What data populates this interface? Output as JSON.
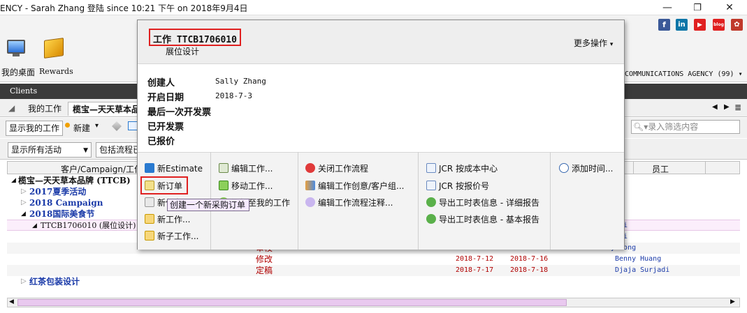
{
  "window": {
    "title": "ENCY  - Sarah Zhang 登陆 since 10:21 下午 on 2018年9月4日",
    "controls": {
      "minimize": "—",
      "maximize": "❐",
      "close": "✕"
    }
  },
  "social": [
    "f",
    "in",
    "▶",
    "blog",
    "✿"
  ],
  "toolbar": {
    "desktop_label": "我的桌面",
    "rewards_label": "Rewards",
    "agency": "COMMUNICATIONS AGENCY (99)",
    "agency_caret": "▾"
  },
  "section_title": "Clients",
  "tabs": {
    "my_jobs": "我的工作",
    "client_tab": "榄宝—天天草本品",
    "nav_prev": "◀",
    "nav_next": "▶",
    "nav_menu": "≣"
  },
  "filters": {
    "show_my_jobs": "显示我的工作",
    "new_btn": "新建",
    "new_caret": "▾",
    "search_placeholder": "录入筛选内容",
    "all_activities": "显示所有活动",
    "include_flow": "包括流程已"
  },
  "grid": {
    "col_client": "客户/Campaign/工作",
    "col_employee": "员工",
    "tree": [
      {
        "indent": 0,
        "arrow": "◢",
        "text": "榄宝—天天草本品牌 (TTCB)",
        "style": "bold-black"
      },
      {
        "indent": 1,
        "arrow": "▷",
        "text": "2017夏季活动",
        "style": "blue"
      },
      {
        "indent": 1,
        "arrow": "▷",
        "text": "2018 Campaign",
        "style": "blue"
      },
      {
        "indent": 1,
        "arrow": "◢",
        "text": "2018国际美食节",
        "style": "blue"
      },
      {
        "indent": 2,
        "arrow": "◢",
        "text": "TTCB1706010 (展位设计)",
        "style": "normal"
      }
    ],
    "employees_partial": [
      "y Qi",
      "y Qi",
      "y Wong"
    ],
    "tasks": [
      {
        "task": "修改",
        "start": "2018-7-12",
        "end": "2018-7-16",
        "employee": "Benny Huang"
      },
      {
        "task": "定稿",
        "start": "2018-7-17",
        "end": "2018-7-18",
        "employee": "Djaja Surjadi"
      }
    ],
    "partial_row": {
      "task": "审校",
      "start": "2018-7-1",
      "end": "2018-7-1"
    },
    "last_row": {
      "arrow": "▷",
      "text": "红茶包装设计"
    }
  },
  "popup": {
    "job_title": "工作 TTCB1706010",
    "job_subtitle": "展位设计",
    "more_ops": "更多操作",
    "more_caret": "▾",
    "info": [
      {
        "label": "创建人",
        "value": "Sally Zhang"
      },
      {
        "label": "开启日期",
        "value": "2018-7-3"
      },
      {
        "label": "最后一次开发票",
        "value": ""
      },
      {
        "label": "已开发票",
        "value": ""
      },
      {
        "label": "已报价",
        "value": ""
      }
    ],
    "col1": [
      "新Estimate",
      "新订单",
      "新任务",
      "新工作...",
      "新子工作..."
    ],
    "col2": [
      "编辑工作...",
      "移动工作...",
      "添加至我的工作"
    ],
    "col3": [
      "关闭工作流程",
      "编辑工作创意/客户组...",
      "编辑工作流程注释..."
    ],
    "col4": [
      "JCR 按成本中心",
      "JCR 按报价号",
      "导出工时表信息 - 详细报告",
      "导出工时表信息 - 基本报告"
    ],
    "col5": [
      "添加时间..."
    ],
    "tooltip": "创建一个新采购订单"
  }
}
